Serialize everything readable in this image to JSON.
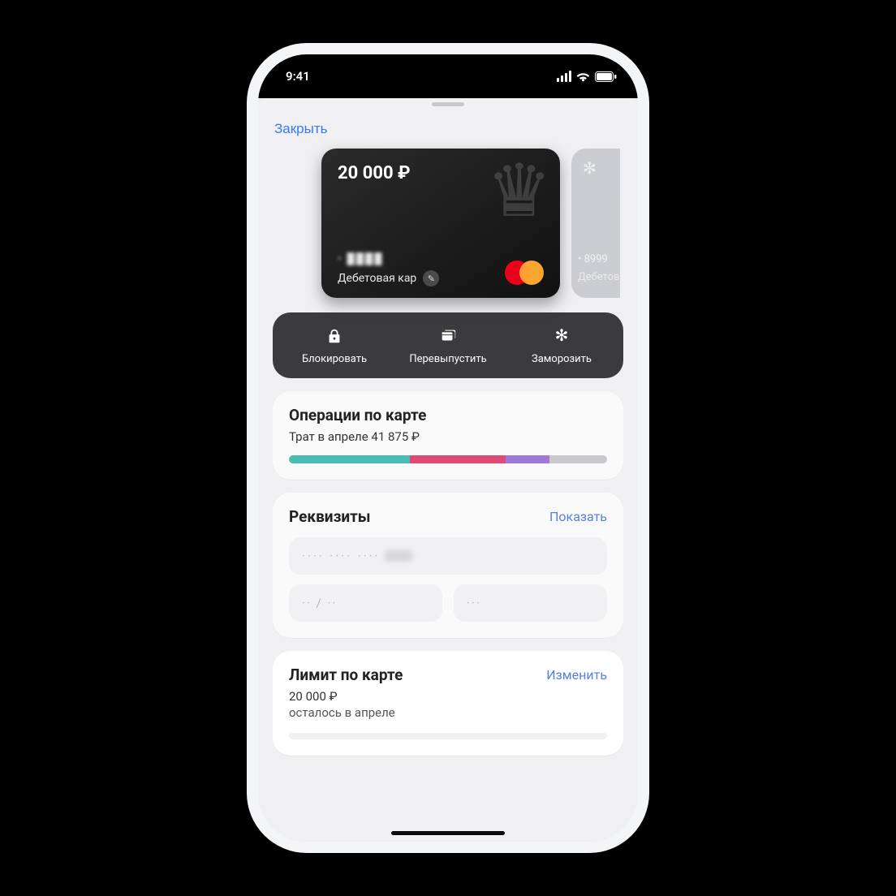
{
  "status": {
    "time": "9:41"
  },
  "close_label": "Закрыть",
  "card": {
    "balance": "20 000 ₽",
    "masked_digits": "• ████",
    "type_label": "Дебетовая кар"
  },
  "peek_card": {
    "last4": "• 8999",
    "label": "Дебетов"
  },
  "actions": {
    "block": "Блокировать",
    "reissue": "Перевыпустить",
    "freeze": "Заморозить"
  },
  "operations": {
    "title": "Операции по карте",
    "subtitle": "Трат в апреле 41 875 ₽",
    "segments": [
      {
        "color": "#49bdb4",
        "pct": 38
      },
      {
        "color": "#e14a74",
        "pct": 30
      },
      {
        "color": "#9d7ad6",
        "pct": 14
      },
      {
        "color": "#c9c9ce",
        "pct": 18
      }
    ]
  },
  "requisites": {
    "title": "Реквизиты",
    "show_label": "Показать",
    "card_number_mask": "····  ····  ····",
    "exp_mask": "·· / ··",
    "cvc_mask": "···"
  },
  "limit": {
    "title": "Лимит по карте",
    "change_label": "Изменить",
    "amount": "20 000 ₽",
    "remaining": "осталось в апреле"
  }
}
